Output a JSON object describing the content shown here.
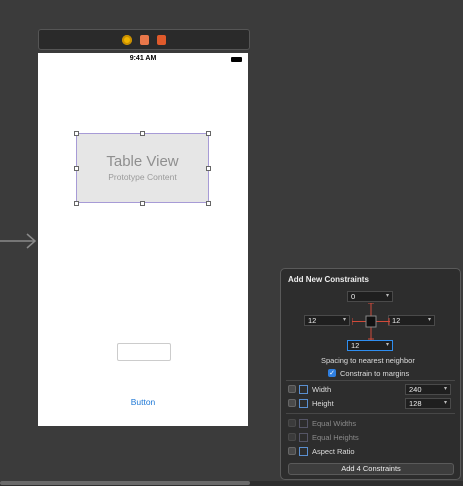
{
  "device": {
    "status_time": "9:41 AM",
    "table_view": {
      "title": "Table View",
      "subtitle": "Prototype Content"
    },
    "button_label": "Button"
  },
  "constraints_panel": {
    "title": "Add New Constraints",
    "top": "0",
    "left": "12",
    "right": "12",
    "bottom": "12",
    "spacing_label": "Spacing to nearest neighbor",
    "constrain_to_margins": "Constrain to margins",
    "width_label": "Width",
    "width_value": "240",
    "height_label": "Height",
    "height_value": "128",
    "equal_widths": "Equal Widths",
    "equal_heights": "Equal Heights",
    "aspect_ratio": "Aspect Ratio",
    "add_button": "Add 4 Constraints"
  },
  "colors": {
    "accent": "#2f7fe0",
    "selection": "#a79bd6",
    "button_text": "#1e78d6"
  }
}
